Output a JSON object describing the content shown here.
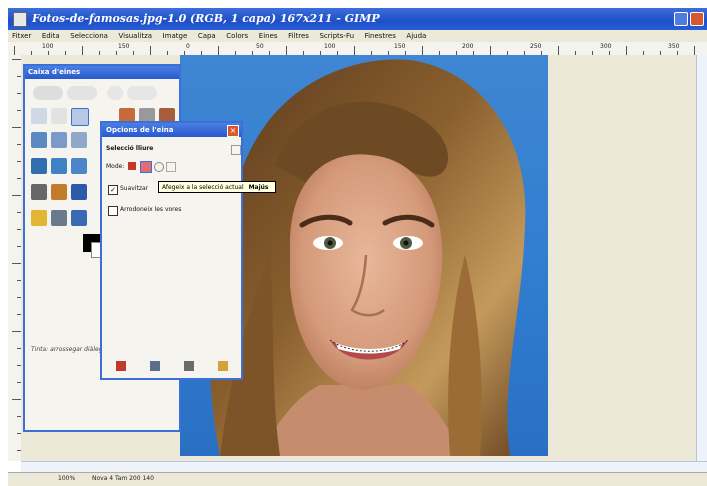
{
  "window": {
    "title": "Fotos-de-famosas.jpg-1.0 (RGB, 1 capa) 167x211 - GIMP",
    "min_icon": "minimize-icon",
    "close_icon": "close-icon"
  },
  "menubar": [
    "Fitxer",
    "Edita",
    "Selecciona",
    "Visualitza",
    "Imatge",
    "Capa",
    "Colors",
    "Eines",
    "Filtres",
    "Scripts-Fu",
    "Finestres",
    "Ajuda"
  ],
  "ruler": {
    "ticks": [
      "100",
      "150",
      "0",
      "50",
      "100",
      "150",
      "200",
      "250",
      "300",
      "350"
    ]
  },
  "toolbox": {
    "title": "Caixa d'eines",
    "status_text": "Tinta: arrossegar diàleg"
  },
  "dialog": {
    "title": "Opcions de l'eina",
    "section": "Selecció lliure",
    "mode_label": "Mode:",
    "antialias_label": "Suavitzar",
    "feather_label": "Arrodoneix les vores",
    "antialias_checked": true,
    "feather_checked": false
  },
  "tooltip": {
    "text": "Afegeix a la selecció actual",
    "shortcut": "Majús"
  },
  "statusbar": {
    "zoom": "100%",
    "info": "Nova 4 Tam 200 140"
  },
  "colors": {
    "accent": "#2858cf",
    "canvas_bg": "#ece9d8"
  }
}
